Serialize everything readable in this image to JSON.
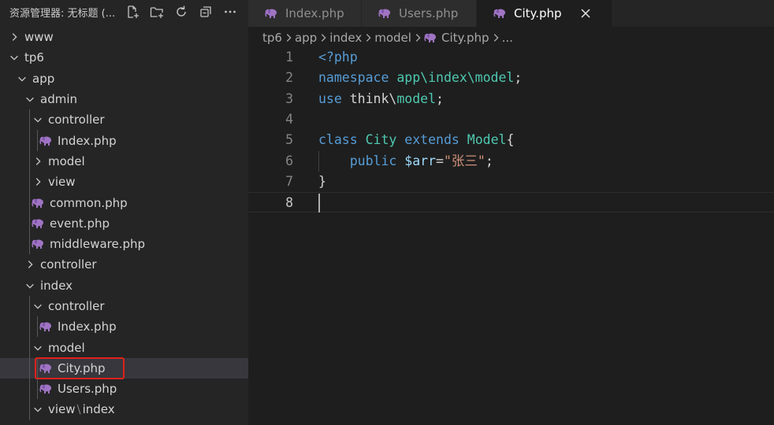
{
  "sidebar": {
    "title": "资源管理器: 无标题 (...",
    "actions": [
      "new-file-icon",
      "new-folder-icon",
      "refresh-icon",
      "collapse-all-icon",
      "more-icon"
    ],
    "tree": [
      {
        "label": "www",
        "type": "folder",
        "expanded": false,
        "depth": 0
      },
      {
        "label": "tp6",
        "type": "folder",
        "expanded": true,
        "depth": 0
      },
      {
        "label": "app",
        "type": "folder",
        "expanded": true,
        "depth": 1
      },
      {
        "label": "admin",
        "type": "folder",
        "expanded": true,
        "depth": 2
      },
      {
        "label": "controller",
        "type": "folder",
        "expanded": true,
        "depth": 3
      },
      {
        "label": "Index.php",
        "type": "php",
        "depth": 4
      },
      {
        "label": "model",
        "type": "folder",
        "expanded": false,
        "depth": 3
      },
      {
        "label": "view",
        "type": "folder",
        "expanded": false,
        "depth": 3
      },
      {
        "label": "common.php",
        "type": "php",
        "depth": 3
      },
      {
        "label": "event.php",
        "type": "php",
        "depth": 3
      },
      {
        "label": "middleware.php",
        "type": "php",
        "depth": 3
      },
      {
        "label": "controller",
        "type": "folder",
        "expanded": false,
        "depth": 2
      },
      {
        "label": "index",
        "type": "folder",
        "expanded": true,
        "depth": 2
      },
      {
        "label": "controller",
        "type": "folder",
        "expanded": true,
        "depth": 3
      },
      {
        "label": "Index.php",
        "type": "php",
        "depth": 4
      },
      {
        "label": "model",
        "type": "folder",
        "expanded": true,
        "depth": 3
      },
      {
        "label": "City.php",
        "type": "php",
        "depth": 4,
        "selected": true,
        "highlighted": true
      },
      {
        "label": "Users.php",
        "type": "php",
        "depth": 4
      },
      {
        "label": "view",
        "label_suffix": "index",
        "type": "folder",
        "expanded": true,
        "depth": 3
      }
    ]
  },
  "tabs": [
    {
      "label": "Index.php",
      "active": false
    },
    {
      "label": "Users.php",
      "active": false
    },
    {
      "label": "City.php",
      "active": true
    }
  ],
  "breadcrumb": {
    "parts": [
      "tp6",
      "app",
      "index",
      "model"
    ],
    "file": "City.php",
    "tail": "..."
  },
  "editor": {
    "current_line": 8,
    "lines": [
      {
        "n": "1",
        "tokens": [
          {
            "t": "<?php",
            "c": "kw"
          }
        ]
      },
      {
        "n": "2",
        "tokens": [
          {
            "t": "namespace",
            "c": "kw"
          },
          {
            "t": " ",
            "c": "plain"
          },
          {
            "t": "app\\index\\model",
            "c": "ns"
          },
          {
            "t": ";",
            "c": "plain"
          }
        ]
      },
      {
        "n": "3",
        "tokens": [
          {
            "t": "use",
            "c": "kw"
          },
          {
            "t": " think\\",
            "c": "plain"
          },
          {
            "t": "model",
            "c": "ns"
          },
          {
            "t": ";",
            "c": "plain"
          }
        ]
      },
      {
        "n": "4",
        "tokens": []
      },
      {
        "n": "5",
        "tokens": [
          {
            "t": "class",
            "c": "kw"
          },
          {
            "t": " ",
            "c": "plain"
          },
          {
            "t": "City",
            "c": "ns"
          },
          {
            "t": " ",
            "c": "plain"
          },
          {
            "t": "extends",
            "c": "kw"
          },
          {
            "t": " ",
            "c": "plain"
          },
          {
            "t": "Model",
            "c": "ns"
          },
          {
            "t": "{",
            "c": "plain"
          }
        ]
      },
      {
        "n": "6",
        "tokens": [
          {
            "t": "    ",
            "c": "plain"
          },
          {
            "t": "public",
            "c": "kw"
          },
          {
            "t": " ",
            "c": "plain"
          },
          {
            "t": "$arr",
            "c": "var"
          },
          {
            "t": "=",
            "c": "plain"
          },
          {
            "t": "\"张三\"",
            "c": "str"
          },
          {
            "t": ";",
            "c": "plain"
          }
        ]
      },
      {
        "n": "7",
        "tokens": [
          {
            "t": "}",
            "c": "plain"
          }
        ]
      },
      {
        "n": "8",
        "tokens": []
      }
    ]
  },
  "colors": {
    "php_icon": "#a074c4",
    "selection_outline": "#e0211b",
    "active_tab_bg": "#1e1e1e"
  }
}
